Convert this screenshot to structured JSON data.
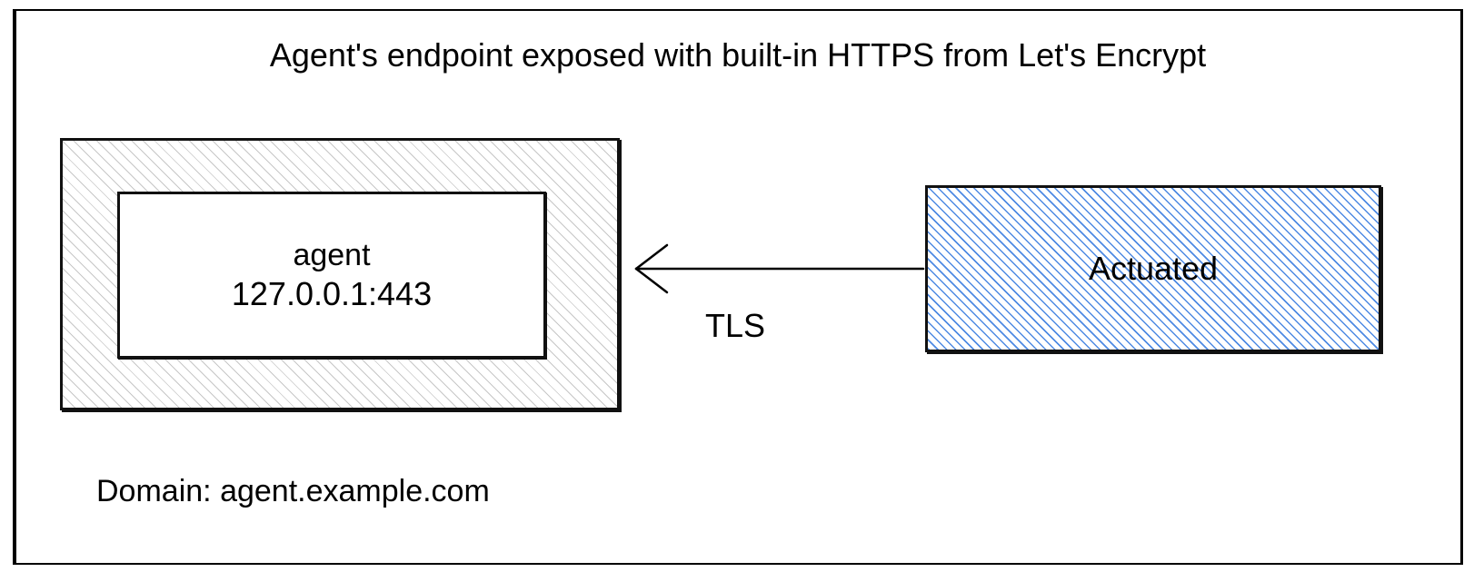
{
  "title": "Agent's endpoint exposed with built-in HTTPS from Let's Encrypt",
  "agent": {
    "name": "agent",
    "address": "127.0.0.1:443"
  },
  "connector": {
    "label": "TLS"
  },
  "actuated": {
    "label": "Actuated"
  },
  "domain": {
    "prefix": "Domain: ",
    "value": "agent.example.com"
  }
}
